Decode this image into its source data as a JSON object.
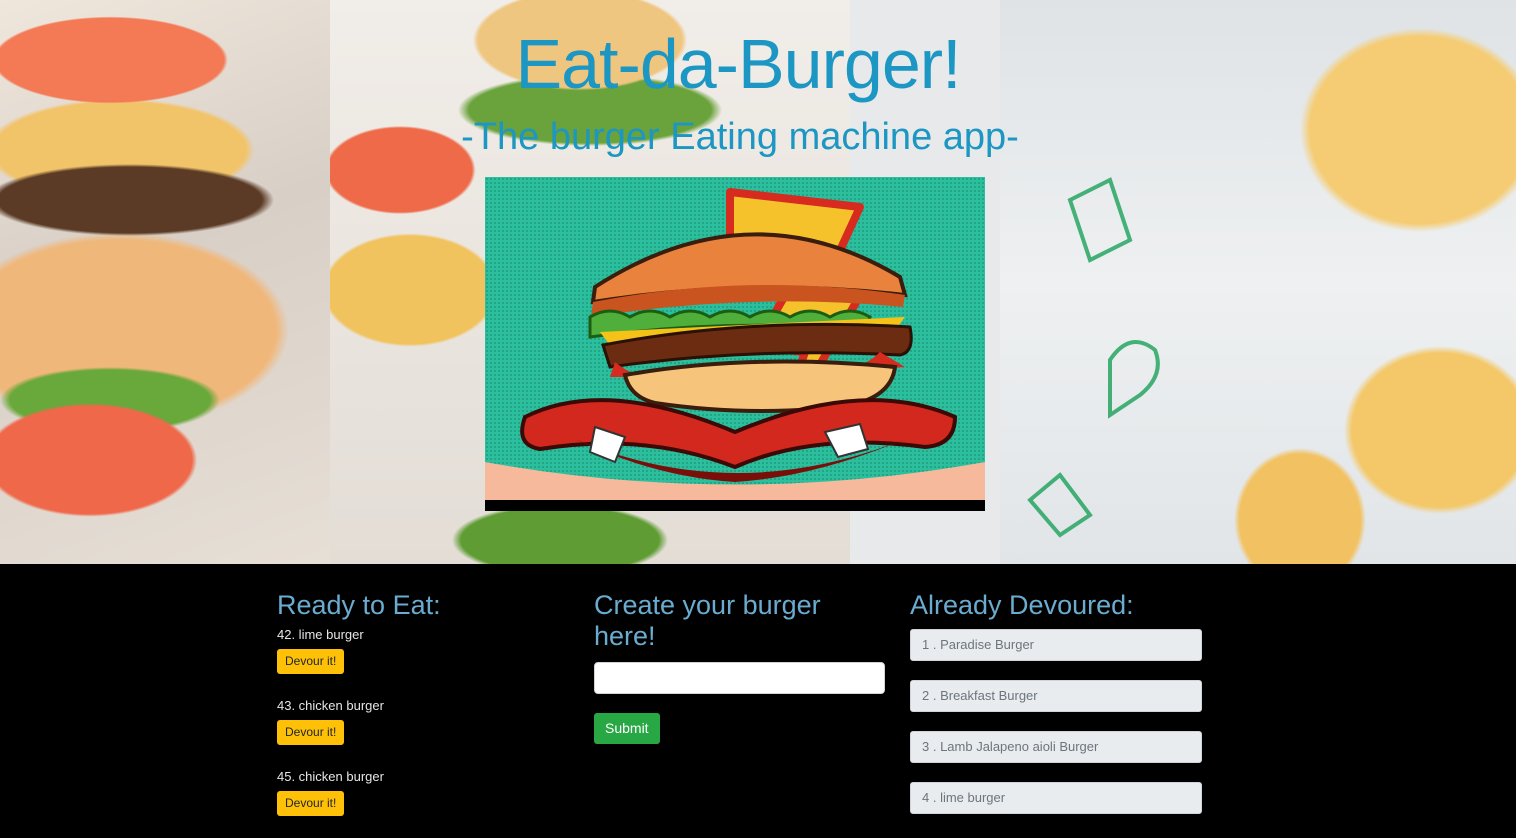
{
  "header": {
    "title": "Eat-da-Burger!",
    "subtitle": "-The burger Eating machine app-"
  },
  "ready": {
    "heading": "Ready to Eat:",
    "items": [
      {
        "label": "42. lime burger",
        "button": "Devour it!"
      },
      {
        "label": "43. chicken burger",
        "button": "Devour it!"
      },
      {
        "label": "45. chicken burger",
        "button": "Devour it!"
      }
    ]
  },
  "create": {
    "heading": "Create your burger here!",
    "input_value": "",
    "submit_label": "Submit"
  },
  "devoured": {
    "heading": "Already Devoured:",
    "items": [
      "1 . Paradise Burger",
      "2 . Breakfast Burger",
      "3 . Lamb Jalapeno aioli Burger",
      "4 . lime burger"
    ]
  },
  "colors": {
    "title": "#1c96c3",
    "heading": "#6aacd0",
    "devour_button": "#ffc107",
    "submit_button": "#28a745",
    "page_background": "#000000"
  }
}
